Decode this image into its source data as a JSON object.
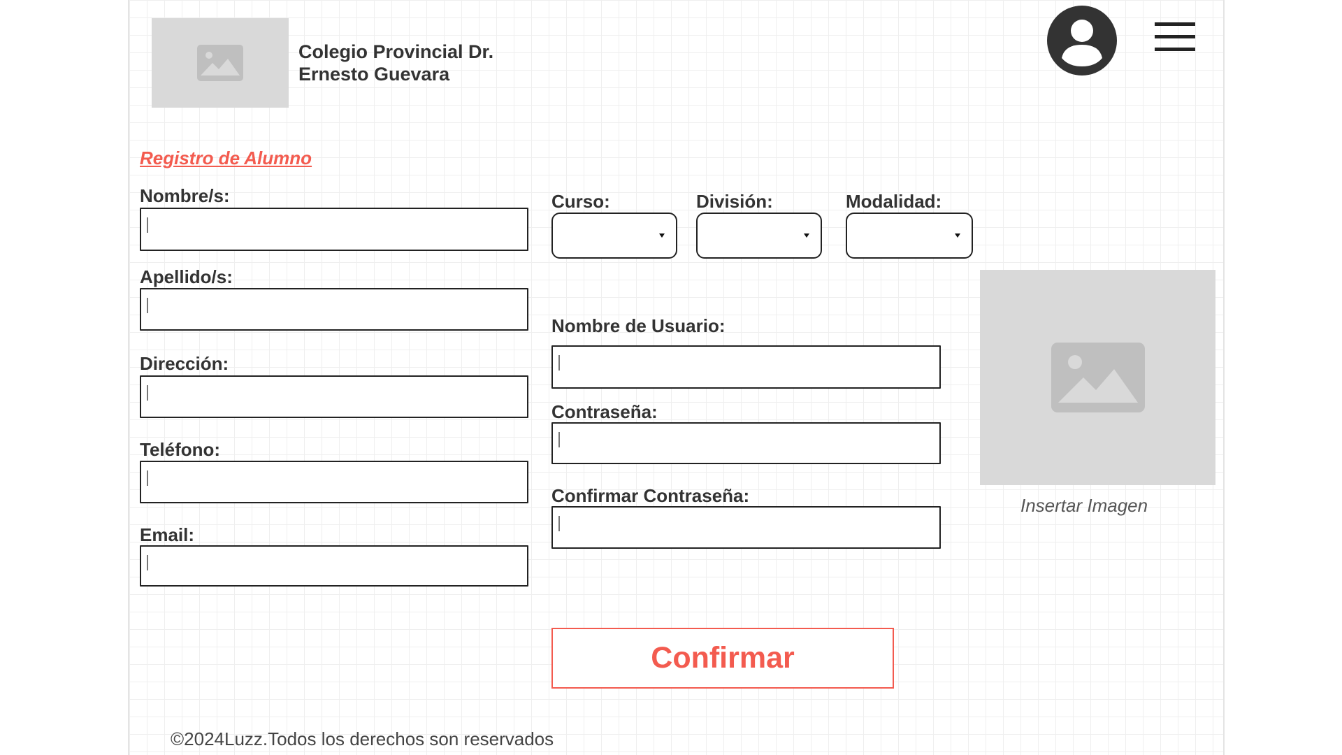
{
  "header": {
    "logo_icon": "image-placeholder-icon",
    "school_name_line1": "Colegio Provincial Dr.",
    "school_name_line2": "Ernesto Guevara",
    "user_icon": "user-account-icon",
    "menu_icon": "hamburger-menu-icon"
  },
  "form": {
    "title": "Registro de Alumno",
    "fields": {
      "nombres": {
        "label": "Nombre/s:",
        "value": ""
      },
      "apellidos": {
        "label": "Apellido/s:",
        "value": ""
      },
      "direccion": {
        "label": "Dirección:",
        "value": ""
      },
      "telefono": {
        "label": "Teléfono:",
        "value": ""
      },
      "email": {
        "label": "Email:",
        "value": ""
      },
      "usuario": {
        "label": "Nombre de Usuario:",
        "value": ""
      },
      "contrasena": {
        "label": "Contraseña:",
        "value": ""
      },
      "confirmar_contrasena": {
        "label": "Confirmar Contraseña:",
        "value": ""
      }
    },
    "selects": {
      "curso": {
        "label": "Curso:",
        "value": ""
      },
      "division": {
        "label": "División:",
        "value": ""
      },
      "modalidad": {
        "label": "Modalidad:",
        "value": ""
      }
    },
    "photo": {
      "icon": "image-placeholder-icon",
      "caption": "Insertar Imagen"
    },
    "submit_label": "Confirmar"
  },
  "footer": {
    "text": "©2024Luzz.Todos los derechos son reservados"
  },
  "colors": {
    "accent": "#f35b4f",
    "text": "#333333",
    "placeholder_bg": "#d9d9d9",
    "icon_gray": "#bfbfbf",
    "grid": "#efefef"
  }
}
